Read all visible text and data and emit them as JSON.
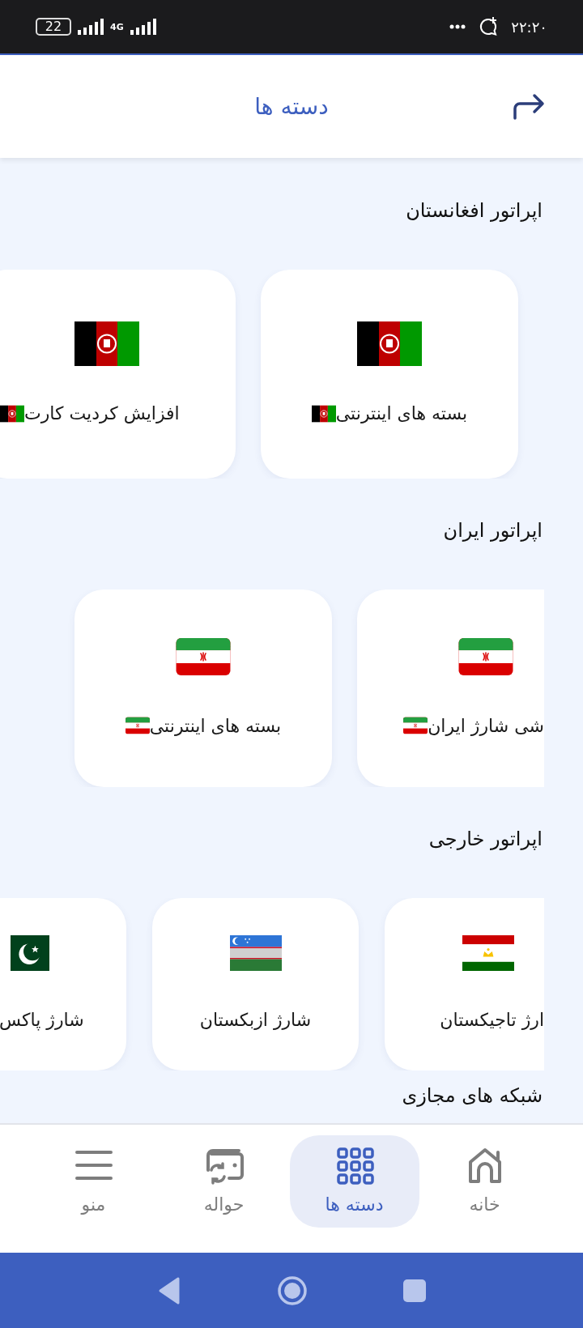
{
  "status_bar": {
    "battery": "22",
    "network": "4G",
    "time": "۲۲:۲۰"
  },
  "header": {
    "title": "دسته ها"
  },
  "sections": [
    {
      "title": "اپراتور افغانستان",
      "cards": [
        {
          "label": "بسته های اینترنتی",
          "kind": "af",
          "emoji_flag": true
        },
        {
          "label": "افزایش کردیت کارت",
          "kind": "af",
          "emoji_flag": true
        }
      ]
    },
    {
      "title": "اپراتور ایران",
      "cards": [
        {
          "label": "شی شارژ ایران",
          "kind": "ir",
          "emoji_flag": true
        },
        {
          "label": "بسته های اینترنتی",
          "kind": "ir",
          "emoji_flag": true
        }
      ]
    },
    {
      "title": "اپراتور خارجی",
      "cards": [
        {
          "label": "ارژ تاجیکستان",
          "kind": "tj",
          "emoji_flag": false
        },
        {
          "label": "شارژ ازبکستان",
          "kind": "uz",
          "emoji_flag": false
        },
        {
          "label": "شارژ پاکس",
          "kind": "pk",
          "emoji_flag": false
        }
      ]
    },
    {
      "title": "شبکه های مجازی"
    }
  ],
  "bottom_nav": [
    {
      "label": "خانه",
      "selected": false
    },
    {
      "label": "دسته ها",
      "selected": true
    },
    {
      "label": "حواله",
      "selected": false
    },
    {
      "label": "منو",
      "selected": false
    }
  ]
}
